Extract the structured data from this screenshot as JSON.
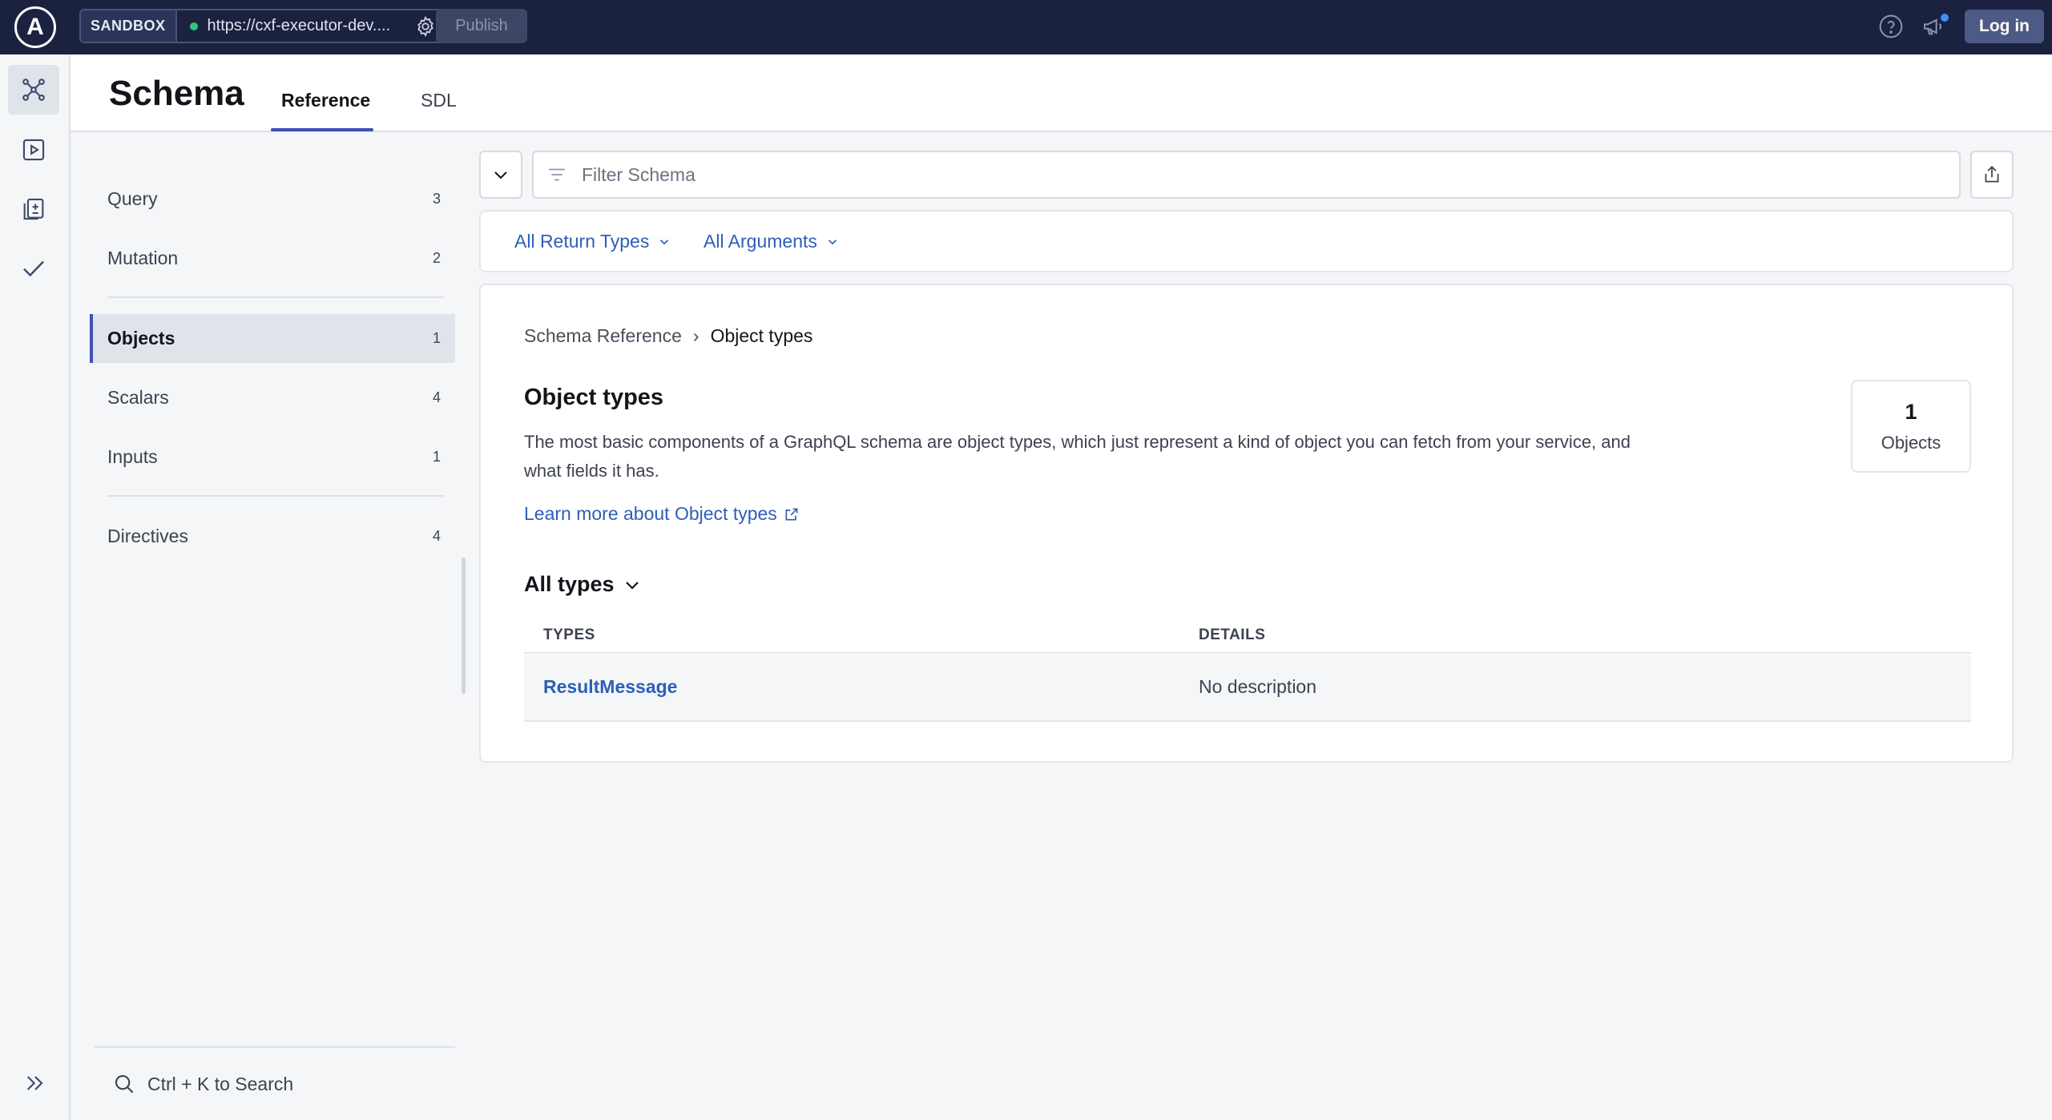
{
  "topbar": {
    "logo_letter": "A",
    "sandbox_label": "SANDBOX",
    "endpoint_url": "https://cxf-executor-dev....",
    "publish_label": "Publish",
    "login_label": "Log in"
  },
  "header": {
    "title": "Schema",
    "tabs": [
      {
        "label": "Reference",
        "active": true
      },
      {
        "label": "SDL",
        "active": false
      }
    ]
  },
  "sidebar": {
    "items": [
      {
        "label": "Query",
        "count": "3"
      },
      {
        "label": "Mutation",
        "count": "2"
      },
      {
        "label": "Objects",
        "count": "1",
        "active": true
      },
      {
        "label": "Scalars",
        "count": "4"
      },
      {
        "label": "Inputs",
        "count": "1"
      },
      {
        "label": "Directives",
        "count": "4"
      }
    ],
    "search_label": "Ctrl + K to Search"
  },
  "filter": {
    "placeholder": "Filter Schema",
    "return_types_label": "All Return Types",
    "arguments_label": "All Arguments"
  },
  "content": {
    "breadcrumb_root": "Schema Reference",
    "breadcrumb_separator": "›",
    "breadcrumb_current": "Object types",
    "title": "Object types",
    "description": "The most basic components of a GraphQL schema are object types, which just represent a kind of object you can fetch from your service, and what fields it has.",
    "learn_more": "Learn more about Object types",
    "count_value": "1",
    "count_label": "Objects",
    "section_label": "All types",
    "table": {
      "columns": [
        "TYPES",
        "DETAILS"
      ],
      "rows": [
        {
          "type": "ResultMessage",
          "details": "No description"
        }
      ]
    }
  },
  "colors": {
    "topbar": "#1b2240",
    "accent": "#3f51b5",
    "link": "#2d5fb8",
    "status_dot": "#36c17a"
  }
}
